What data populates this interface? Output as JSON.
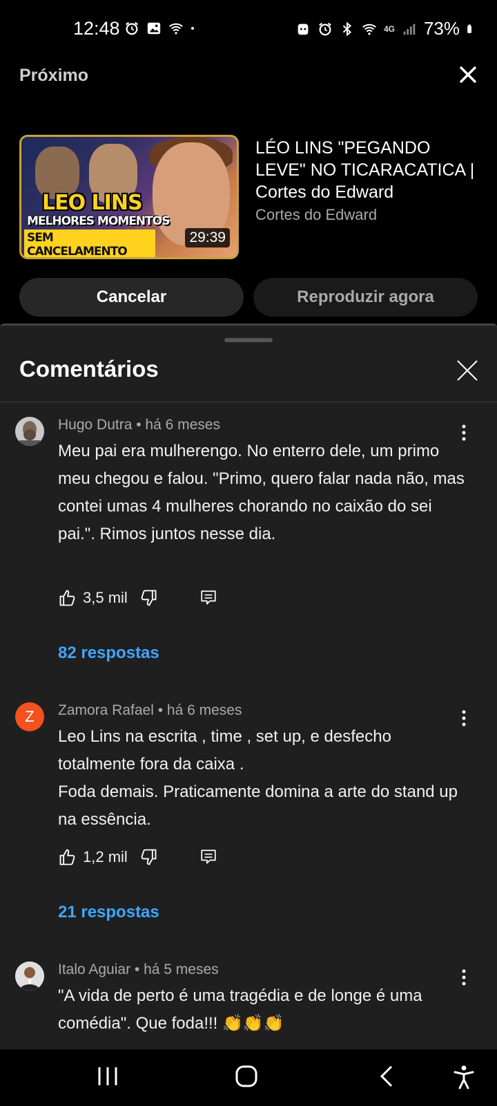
{
  "status_bar": {
    "time": "12:48",
    "battery_percent": "73%",
    "network_label": "4G"
  },
  "up_next": {
    "label": "Próximo",
    "video": {
      "title": "LÉO LINS \"PEGANDO LEVE\" NO TICARACATICA | Cortes do Edward",
      "channel": "Cortes do Edward",
      "duration": "29:39",
      "thumbnail_text_1": "LEO LINS",
      "thumbnail_text_2": "MELHORES MOMENTOS",
      "thumbnail_text_3": "SEM CANCELAMENTO"
    },
    "cancel_label": "Cancelar",
    "play_label": "Reproduzir agora"
  },
  "comments_panel": {
    "title": "Comentários",
    "comments": [
      {
        "author_meta": "Hugo Dutra • há 6 meses",
        "text": "Meu pai era mulherengo. No enterro dele, um primo meu chegou e falou. \"Primo, quero falar nada não, mas contei umas 4 mulheres chorando no caixão do sei pai.\". Rimos juntos nesse dia.",
        "likes": "3,5 mil",
        "replies": "82 respostas"
      },
      {
        "author_meta": "Zamora Rafael • há 6 meses",
        "avatar_letter": "Z",
        "text_line_1": "Leo Lins na escrita , time , set up,  e desfecho totalmente fora da caixa .",
        "text_line_2": "Foda demais.  Praticamente domina a arte do stand up na essência.",
        "likes": "1,2 mil",
        "replies": "21 respostas"
      },
      {
        "author_meta": "Italo Aguiar • há 5 meses",
        "text": "\"A vida de perto é uma tragédia e de longe é uma comédia\". Que foda!!! 👏👏👏"
      }
    ]
  },
  "colors": {
    "background": "#000000",
    "sheet": "#1f1f1f",
    "link_blue": "#3ea6ff",
    "avatar_orange": "#f4511e"
  }
}
